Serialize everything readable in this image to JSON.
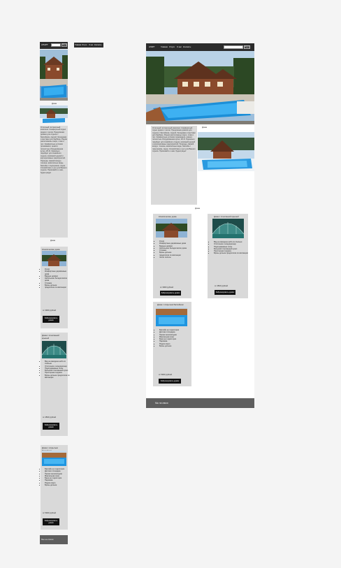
{
  "header": {
    "brand": "АПАРТ",
    "search_placeholder": "",
    "search_button": "Поиск",
    "nav": [
      "Главная",
      "Услуги",
      "О нас",
      "Контакты"
    ]
  },
  "description": "Отличный гостиничный комплекс. Комфортный отдых рядом с лесом. Предлагаем домики для отдыха с бассейном, сауной, беседками и местами для барбекю. Рядом расположены озеро, пляж и лес. Комфортные условия проживания, ремонт, полностью оборудованная кухня, Wi-Fi. Идеально подойдет для семейного отдыха, компаний друзей и корпоративных мероприятий. Природа, свежий воздух, тишина, живописные виды, бассейн с подогревом, сауна. Спокойствие и уют для Вашего отдыха. Приезжайте к нам, будем рады!",
  "photo_caption": "Дома",
  "cards": [
    {
      "title": "Классические дома",
      "features": [
        "Кухня",
        "Комфортные деревянные дома",
        "Банные домики",
        "Небольшие беседки возле дома",
        "Стоянка",
        "Бронь дольше",
        "предоплата по квитанции",
        "после оплаты"
      ],
      "price": "от 3000 рублей",
      "button": "Забронировать домик"
    },
    {
      "title": "Дома с стеклянной крышей",
      "features": [
        "Вид на звездное небо из спальни",
        "Отопление и кондиционер",
        "Подогреваемые полы",
        "Большой стеклянный купол",
        "Просторная терраса",
        "Бронь дольше предоплата по квитанции"
      ],
      "price": "от 4500 рублей",
      "button": "Забронировать домик"
    },
    {
      "title": "Дома с открытым бассейном",
      "features": [
        "Бассейн на территории",
        "Детская площадка",
        "Прокат велосипедов",
        "Мангальная зона",
        "Баня на территории",
        "Парковка",
        "Рядом озеро",
        "Бронь дольше"
      ],
      "price": "от 5000 рублей",
      "button": "Забронировать домик"
    }
  ],
  "footer": {
    "text": "Мы на связи"
  }
}
